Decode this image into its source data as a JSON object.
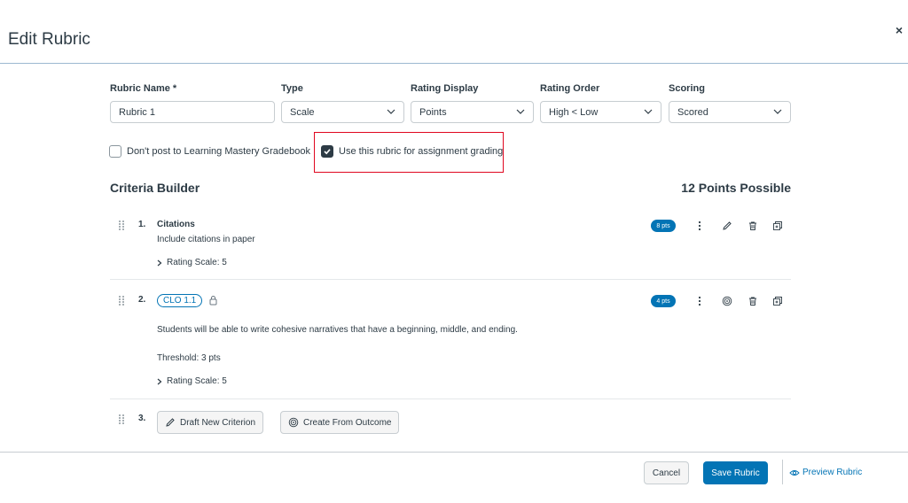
{
  "header": {
    "title": "Edit Rubric",
    "close_glyph": "×"
  },
  "fields": {
    "name": {
      "label": "Rubric Name *",
      "value": "Rubric 1"
    },
    "type": {
      "label": "Type",
      "value": "Scale"
    },
    "rating_display": {
      "label": "Rating Display",
      "value": "Points"
    },
    "rating_order": {
      "label": "Rating Order",
      "value": "High < Low"
    },
    "scoring": {
      "label": "Scoring",
      "value": "Scored"
    }
  },
  "options": {
    "dont_post": {
      "label": "Don't post to Learning Mastery Gradebook",
      "checked": false
    },
    "use_for_grading": {
      "label": "Use this rubric for assignment grading",
      "checked": true
    }
  },
  "builder": {
    "title": "Criteria Builder",
    "points_possible": "12 Points Possible"
  },
  "criteria": [
    {
      "number": "1.",
      "title": "Citations",
      "description": "Include citations in paper",
      "rating_scale": "Rating Scale: 5",
      "points": "8 pts"
    },
    {
      "number": "2.",
      "outcome_tag": "CLO 1.1",
      "description": "Students will be able to write cohesive narratives that have a beginning, middle, and ending.",
      "threshold": "Threshold: 3 pts",
      "rating_scale": "Rating Scale: 5",
      "points": "4 pts"
    }
  ],
  "new_row": {
    "number": "3.",
    "draft_label": "Draft New Criterion",
    "outcome_label": "Create From Outcome"
  },
  "footer": {
    "cancel": "Cancel",
    "save": "Save Rubric",
    "preview": "Preview Rubric"
  },
  "colors": {
    "accent": "#0374b5",
    "highlight": "#e0061f",
    "text": "#2d3b45"
  }
}
